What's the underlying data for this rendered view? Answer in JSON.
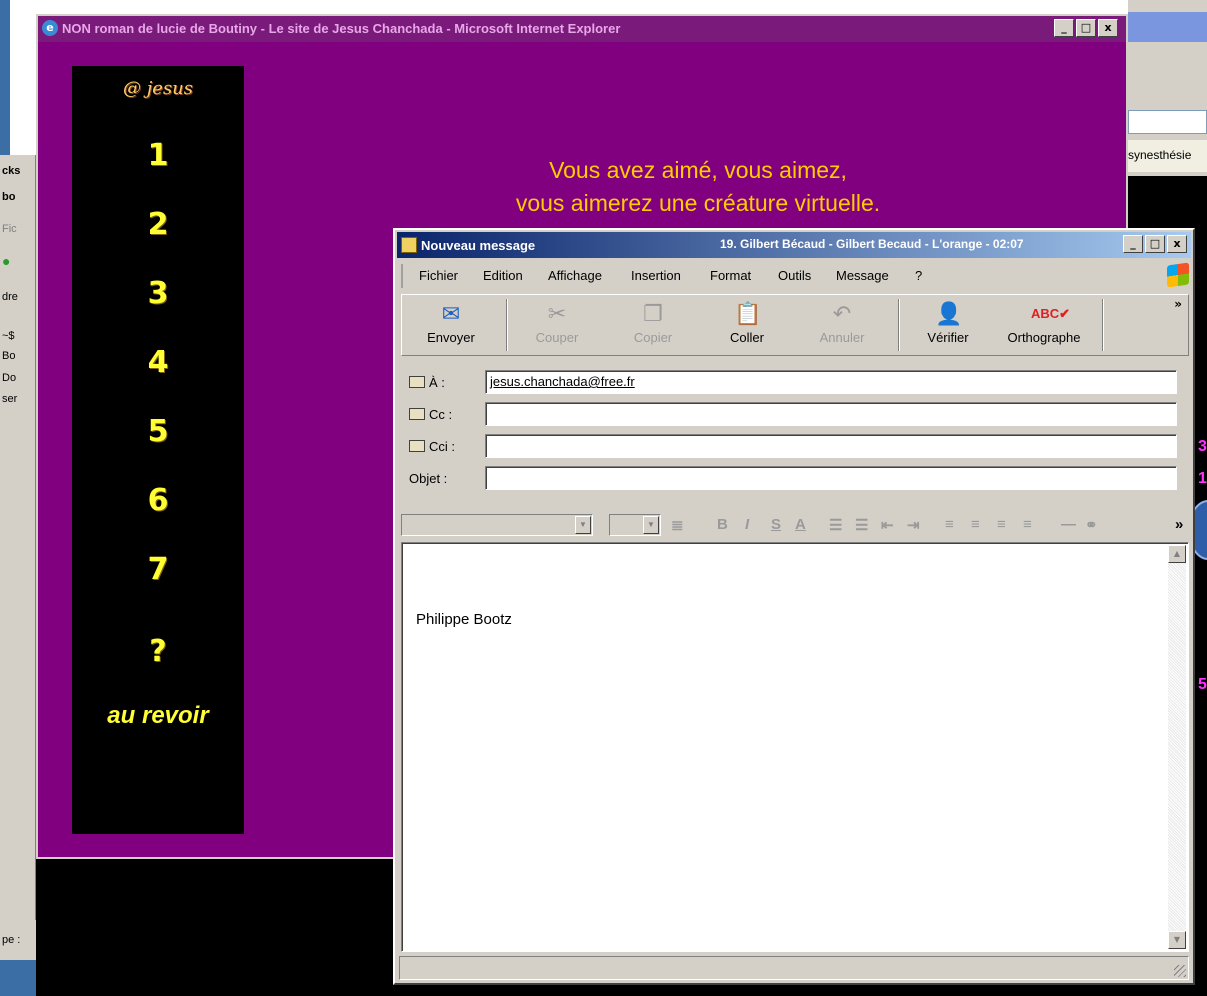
{
  "browser_window": {
    "title": "NON roman de lucie de Boutiny - Le site de Jesus Chanchada - Microsoft Internet Explorer",
    "caption_buttons": [
      "_",
      "□",
      "x"
    ]
  },
  "page": {
    "nav_header": "@ jesus",
    "nav_items": [
      "1",
      "2",
      "3",
      "4",
      "5",
      "6",
      "7",
      "?"
    ],
    "nav_footer": "au revoir",
    "headline_line1": "Vous avez aimé, vous aimez,",
    "headline_line2": "vous aimerez une créature virtuelle.",
    "background_color": "#800080",
    "nav_text_color": "#ffff33"
  },
  "background_window": {
    "tab_text": "synesthésie",
    "fragments": [
      "3",
      "1",
      "5"
    ]
  },
  "left_panel_fragments": [
    "cks",
    "bo",
    "Fic",
    "dre",
    "~$",
    "Bo",
    "Do",
    "ser",
    "pe :"
  ],
  "compose_window": {
    "title": "Nouveau message",
    "now_playing": "19. Gilbert Bécaud - Gilbert Becaud - L'orange - 02:07",
    "caption_buttons": [
      "_",
      "□",
      "x"
    ],
    "menu": [
      "Fichier",
      "Edition",
      "Affichage",
      "Insertion",
      "Format",
      "Outils",
      "Message",
      "?"
    ],
    "toolbar": {
      "send": "Envoyer",
      "cut": "Couper",
      "copy": "Copier",
      "paste": "Coller",
      "undo": "Annuler",
      "check": "Vérifier",
      "spelling": "Orthographe",
      "more": "»"
    },
    "fields": {
      "to_label": "À :",
      "to_value": "jesus.chanchada@free.fr",
      "cc_label": "Cc :",
      "cc_value": "",
      "bcc_label": "Cci :",
      "bcc_value": "",
      "subject_label": "Objet :",
      "subject_value": ""
    },
    "body_text": "Philippe Bootz"
  }
}
